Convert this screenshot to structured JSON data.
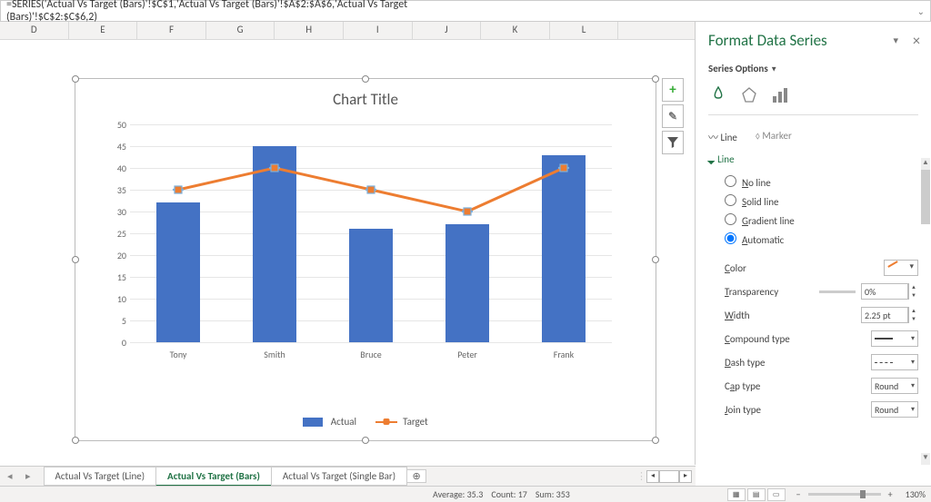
{
  "formula": "=SERIES('Actual Vs Target (Bars)'!$C$1,'Actual Vs Target (Bars)'!$A$2:$A$6,'Actual Vs Target (Bars)'!$C$2:$C$6,2)",
  "col_headers": [
    "D",
    "E",
    "F",
    "G",
    "H",
    "I",
    "J",
    "K",
    "L"
  ],
  "chart_buttons": {
    "plus": "+",
    "brush": "✎",
    "filter": "▾"
  },
  "chart_title": "Chart Title",
  "chart_data": {
    "type": "bar+line",
    "categories": [
      "Tony",
      "Smith",
      "Bruce",
      "Peter",
      "Frank"
    ],
    "series": [
      {
        "name": "Actual",
        "type": "bar",
        "values": [
          32,
          45,
          26,
          27,
          43
        ]
      },
      {
        "name": "Target",
        "type": "line",
        "values": [
          35,
          40,
          35,
          30,
          40
        ]
      }
    ],
    "ylim": [
      0,
      50
    ],
    "ytick": 5,
    "legend": {
      "position": "bottom"
    }
  },
  "panel": {
    "title": "Format Data Series",
    "subtitle": "Series Options",
    "tabs": {
      "line": "Line",
      "marker": "Marker"
    },
    "section": "Line",
    "radios": {
      "none": "No line",
      "solid": "Solid line",
      "gradient": "Gradient line",
      "auto": "Automatic"
    },
    "radio_selected": "auto",
    "fields": {
      "color": "Color",
      "transparency": "Transparency",
      "transparency_val": "0%",
      "width": "Width",
      "width_val": "2.25 pt",
      "compound": "Compound type",
      "dash": "Dash type",
      "cap": "Cap type",
      "cap_val": "Round",
      "join": "Join type",
      "join_val": "Round"
    }
  },
  "sheet_tabs": {
    "tab1": "Actual Vs Target (Line)",
    "tab2": "Actual Vs Target (Bars)",
    "tab3": "Actual Vs Target (Single Bar)",
    "add": "⊕"
  },
  "status": {
    "average": "Average: 35.3",
    "count": "Count: 17",
    "sum": "Sum: 353",
    "zoom": "130%"
  }
}
